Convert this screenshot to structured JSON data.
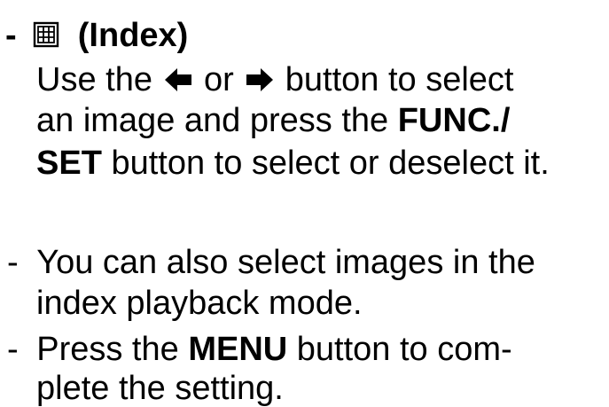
{
  "heading": {
    "dash": "-",
    "icon": "index-grid-icon",
    "title": "(Index)"
  },
  "instruction": {
    "line1_pre": "Use the",
    "left_arrow_icon": "left-arrow-icon",
    "line1_or": "or",
    "right_arrow_icon": "right-arrow-icon",
    "line1_post": "button to select",
    "line2_pre": "an image and press the",
    "line2_bold": "FUNC./",
    "line3_bold": "SET",
    "line3_post": "button to select or deselect it."
  },
  "notes": [
    {
      "dash": "-",
      "line1": "You can also select images in the",
      "line2": "index playback mode."
    },
    {
      "dash": "-",
      "line1_pre": "Press the",
      "line1_bold": "MENU",
      "line1_post": "button to com-",
      "line2": "plete the setting."
    }
  ]
}
